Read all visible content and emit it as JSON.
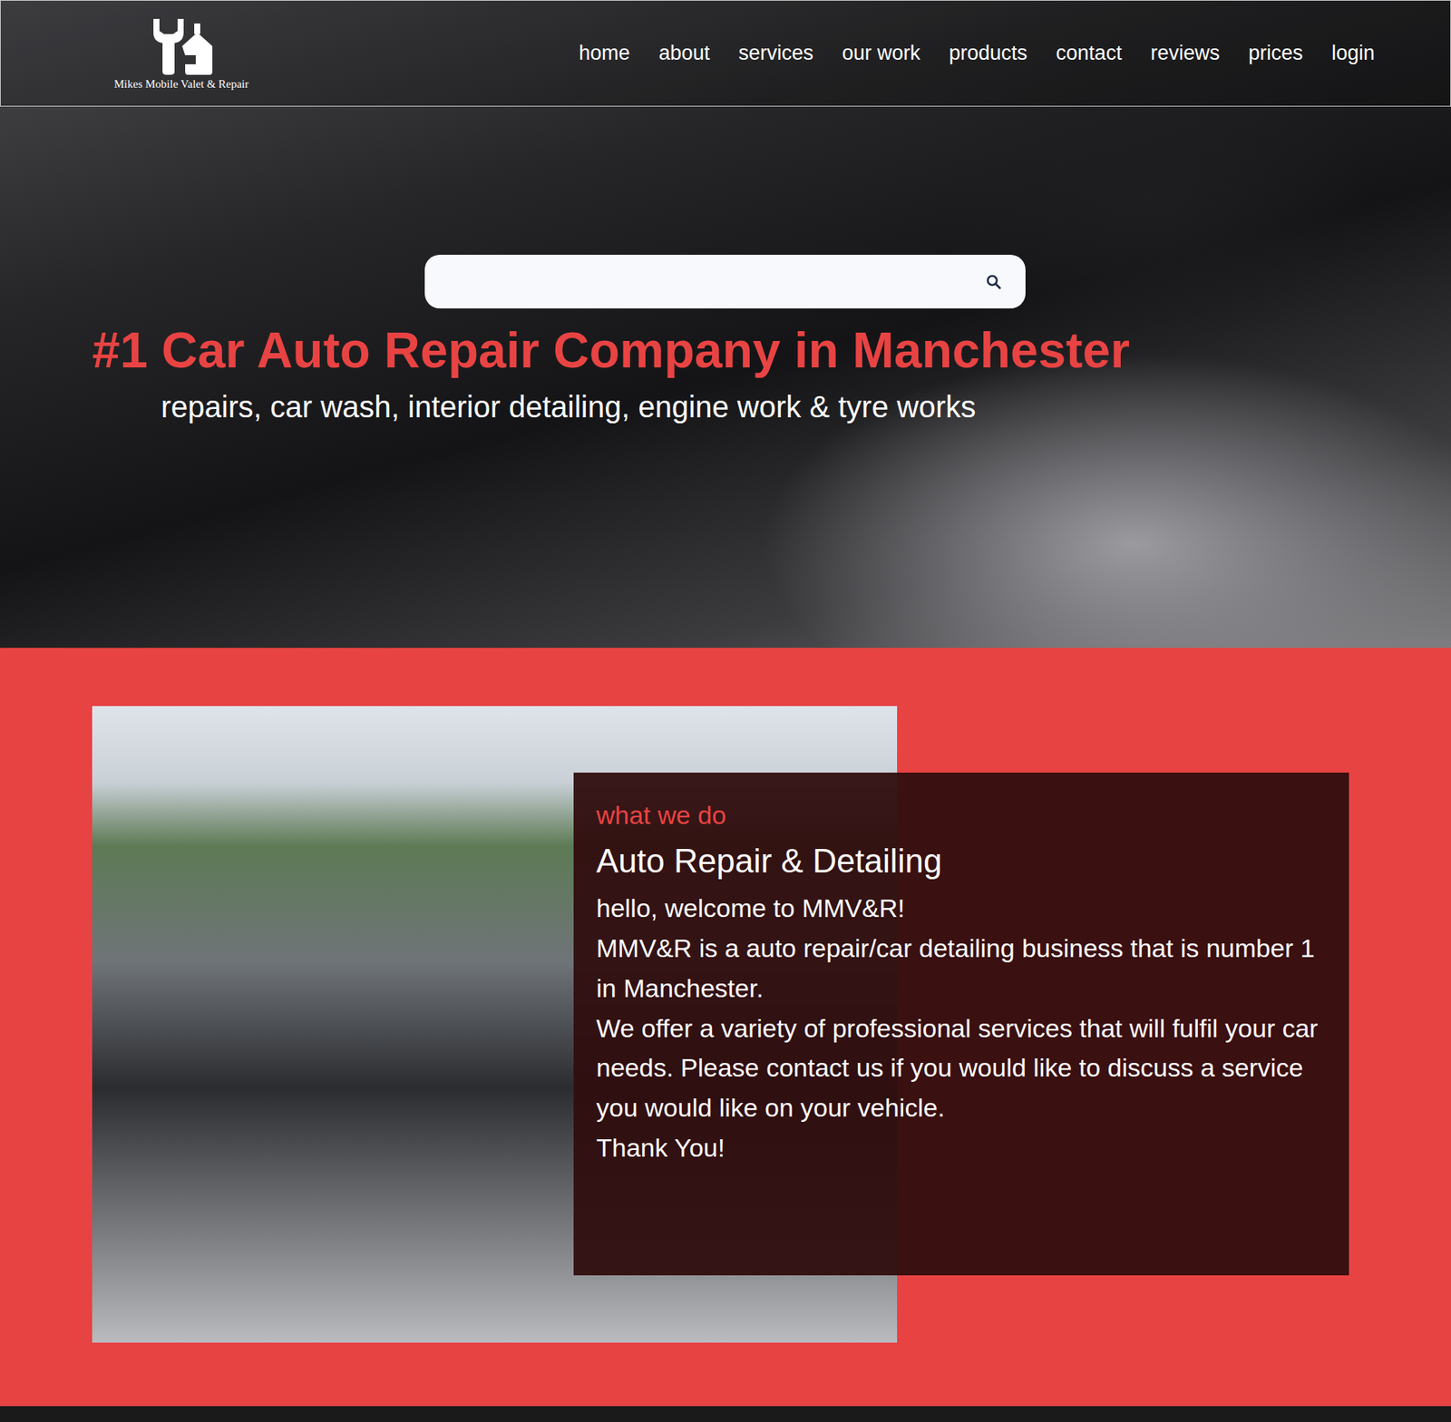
{
  "logo": {
    "text": "Mikes Mobile Valet & Repair"
  },
  "nav": [
    {
      "label": "home"
    },
    {
      "label": "about"
    },
    {
      "label": "services"
    },
    {
      "label": "our work"
    },
    {
      "label": "products"
    },
    {
      "label": "contact"
    },
    {
      "label": "reviews"
    },
    {
      "label": "prices"
    },
    {
      "label": "login"
    }
  ],
  "hero": {
    "title": "#1 Car Auto Repair Company in Manchester",
    "subtitle": "repairs, car wash, interior detailing, engine work & tyre works"
  },
  "about": {
    "eyebrow": "what we do",
    "heading": "Auto Repair & Detailing",
    "paragraphs": [
      "hello, welcome to MMV&R!",
      "MMV&R is a auto repair/car detailing business that is number 1 in Manchester.",
      "We offer a variety of professional services that will fulfil your car needs. Please contact us if you would like to discuss a service you would like on your vehicle.",
      "Thank You!"
    ]
  }
}
